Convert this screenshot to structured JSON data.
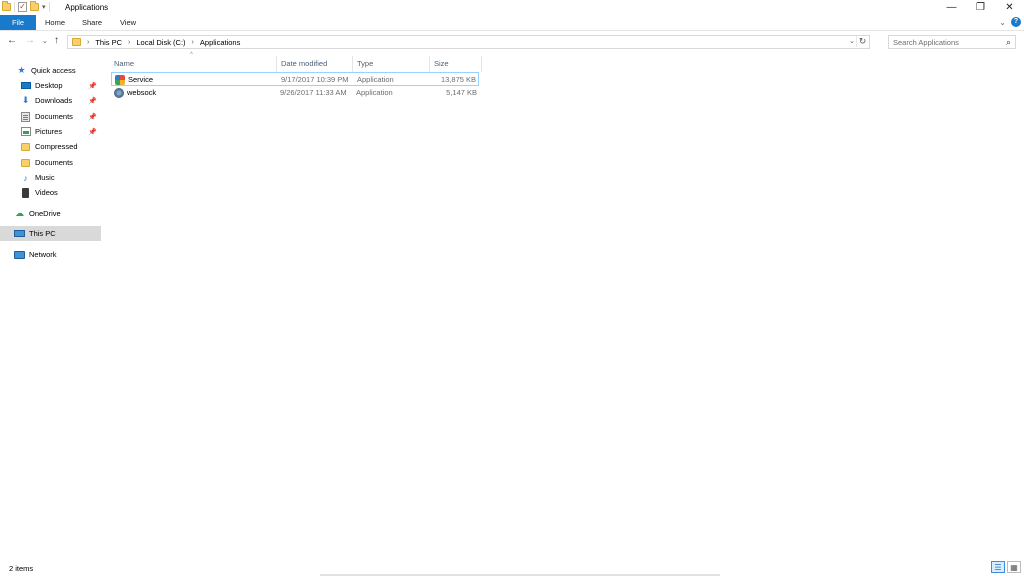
{
  "window": {
    "title": "Applications",
    "minimize_icon": "minimize-icon",
    "restore_icon": "restore-icon",
    "close_icon": "close-icon"
  },
  "ribbon": {
    "tabs": [
      "File",
      "Home",
      "Share",
      "View"
    ]
  },
  "address": {
    "breadcrumbs": [
      "This PC",
      "Local Disk (C:)",
      "Applications"
    ]
  },
  "search": {
    "placeholder": "Search Applications"
  },
  "sidebar": {
    "items": [
      {
        "label": "Quick access",
        "icon": "star-icon",
        "pinned": false
      },
      {
        "label": "Desktop",
        "icon": "desktop-icon",
        "pinned": true
      },
      {
        "label": "Downloads",
        "icon": "download-icon",
        "pinned": true
      },
      {
        "label": "Documents",
        "icon": "documents-icon",
        "pinned": true
      },
      {
        "label": "Pictures",
        "icon": "pictures-icon",
        "pinned": true
      },
      {
        "label": "Compressed",
        "icon": "folder-icon",
        "pinned": false
      },
      {
        "label": "Documents",
        "icon": "folder-icon",
        "pinned": false
      },
      {
        "label": "Music",
        "icon": "music-icon",
        "pinned": false
      },
      {
        "label": "Videos",
        "icon": "videos-icon",
        "pinned": false
      },
      {
        "label": "OneDrive",
        "icon": "onedrive-icon",
        "pinned": false
      },
      {
        "label": "This PC",
        "icon": "this-pc-icon",
        "pinned": false,
        "selected": true
      },
      {
        "label": "Network",
        "icon": "network-icon",
        "pinned": false
      }
    ]
  },
  "filelist": {
    "columns": [
      "Name",
      "Date modified",
      "Type",
      "Size"
    ],
    "rows": [
      {
        "name": "Service",
        "date": "9/17/2017 10:39 PM",
        "type": "Application",
        "size": "13,875 KB",
        "icon": "service-app-icon"
      },
      {
        "name": "websock",
        "date": "9/26/2017 11:33 AM",
        "type": "Application",
        "size": "5,147 KB",
        "icon": "websock-app-icon"
      }
    ]
  },
  "status": {
    "item_count": "2 items"
  },
  "colors": {
    "accent": "#1979ca",
    "selected_nav": "#d9d9d9",
    "selection_border": "#99d1ff"
  }
}
